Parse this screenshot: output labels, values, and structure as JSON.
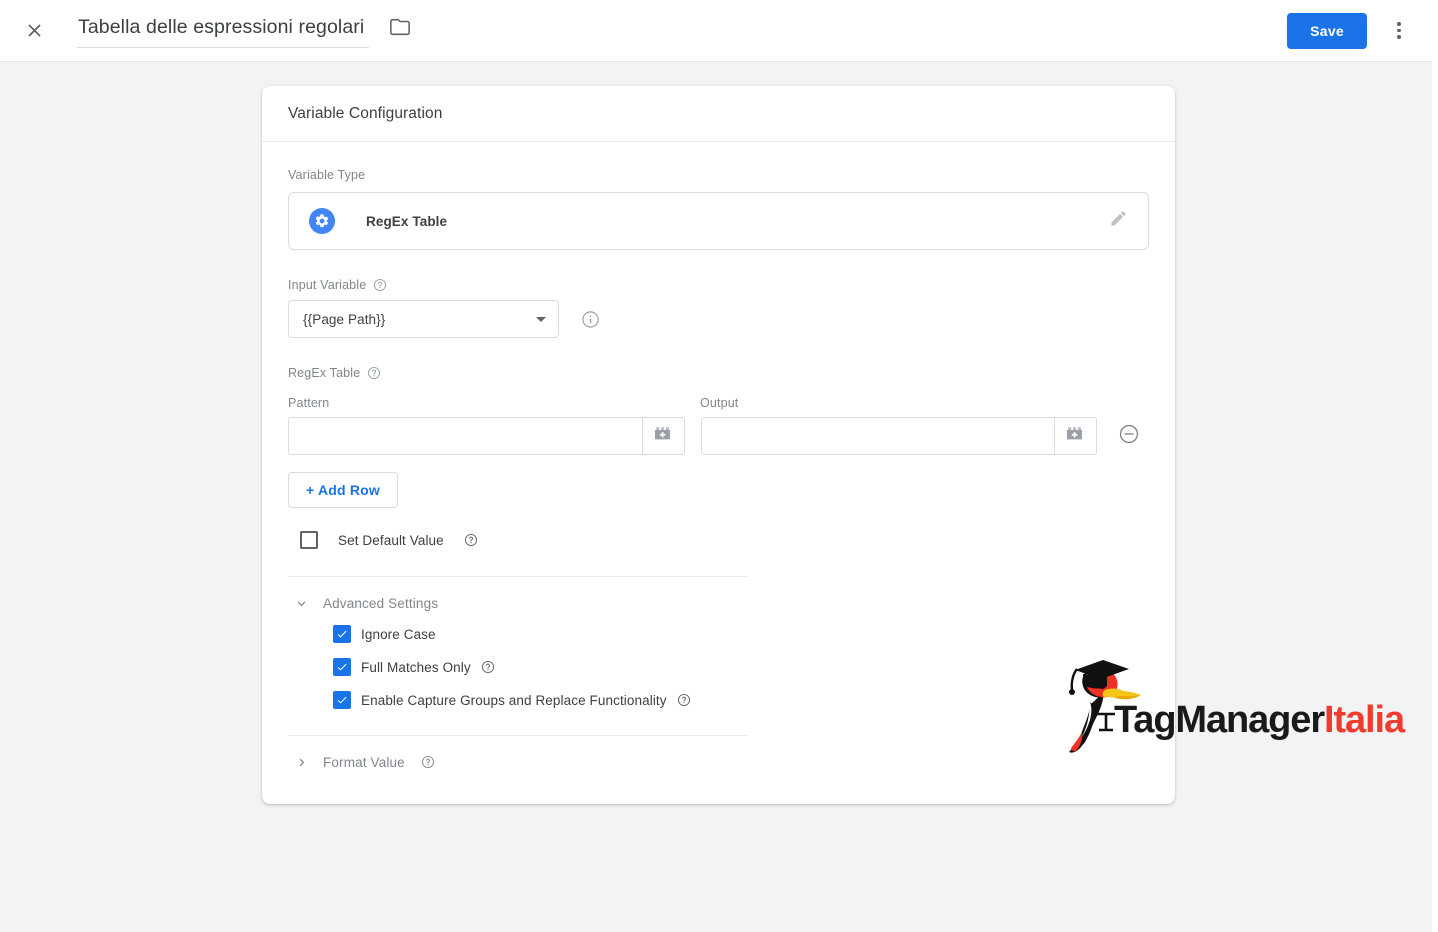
{
  "topbar": {
    "close_icon": "close-icon",
    "doc_title": "Tabella delle espressioni regolari",
    "folder_icon": "folder-icon",
    "save_label": "Save",
    "more_icon": "more-vert-icon"
  },
  "card": {
    "header_title": "Variable Configuration",
    "variable_type": {
      "label": "Variable Type",
      "icon": "gear-circle-icon",
      "name": "RegEx Table",
      "edit_icon": "pencil-icon"
    },
    "input_variable": {
      "label": "Input Variable",
      "help_icon": "help-circle-icon",
      "value": "{{Page Path}}",
      "placeholder": "",
      "dropdown_icon": "chevron-down-icon",
      "info_icon": "info-circle-icon"
    },
    "regex_table": {
      "label": "RegEx Table",
      "help_icon": "help-circle-icon",
      "columns": [
        "Pattern",
        "Output"
      ],
      "rows": [
        {
          "pattern": "",
          "pattern_placeholder": "",
          "output": "",
          "output_placeholder": "",
          "variable_picker_icon": "variable-brick-icon",
          "remove_icon": "remove-circle-icon"
        }
      ],
      "add_row_label": "+ Add Row"
    },
    "set_default_value": {
      "label": "Set Default Value",
      "checked": false,
      "help_icon": "help-circle-icon"
    },
    "advanced_settings": {
      "label": "Advanced Settings",
      "expanded": true,
      "caret_icon": "chevron-down-icon",
      "options": [
        {
          "label": "Ignore Case",
          "checked": true,
          "help_icon": ""
        },
        {
          "label": "Full Matches Only",
          "checked": true,
          "help_icon": "help-circle-icon"
        },
        {
          "label": "Enable Capture Groups and Replace Functionality",
          "checked": true,
          "help_icon": "help-circle-icon"
        }
      ]
    },
    "format_value": {
      "label": "Format Value",
      "expanded": false,
      "caret_icon": "chevron-right-icon",
      "help_icon": "help-circle-icon"
    }
  },
  "logo": {
    "icon": "woodpecker-graduate-icon",
    "text_primary": "TagManager",
    "text_accent": "Italia",
    "accent_color": "#f23b2f",
    "primary_color": "#1a1a1a"
  },
  "colors": {
    "brand_blue": "#1a73e8",
    "page_background": "#f1f3f4",
    "card_background": "#ffffff",
    "text_primary": "#3c4043",
    "text_secondary": "#80868b"
  }
}
